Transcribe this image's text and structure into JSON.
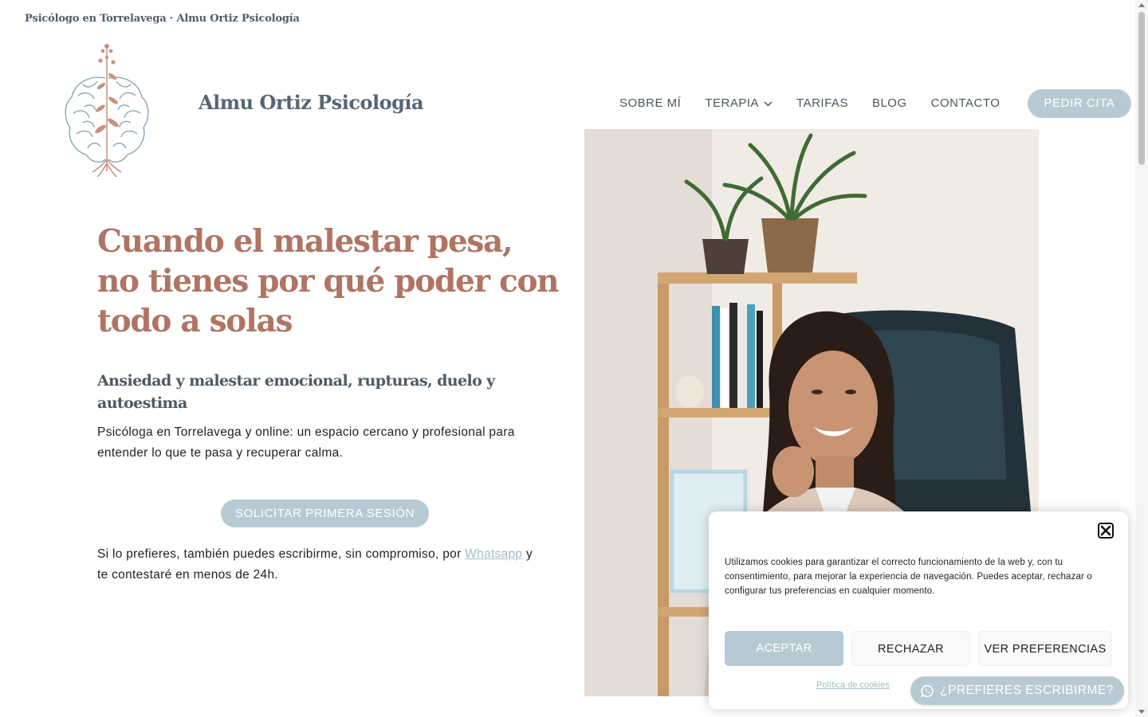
{
  "site": {
    "top_title": "Psicólogo en Torrelavega · Almu Ortiz Psicología",
    "brand_name": "Almu Ortiz Psicología",
    "logo_icon": "brain-tree-logo-icon"
  },
  "nav": {
    "items": [
      {
        "label": "SOBRE MÍ"
      },
      {
        "label": "TERAPIA",
        "has_dropdown": true
      },
      {
        "label": "TARIFAS"
      },
      {
        "label": "BLOG"
      },
      {
        "label": "CONTACTO"
      }
    ],
    "cta_label": "PEDIR CITA"
  },
  "hero": {
    "title": "Cuando el malestar pesa, no tienes por qué poder con todo a solas",
    "subtitle": "Ansiedad y malestar emocional, rupturas, duelo y autoestima",
    "text": "Psicóloga en Torrelavega y online: un espacio cercano y profesional para entender lo que te pasa y recuperar calma.",
    "button_label": "SOLICITAR PRIMERA SESIÓN",
    "note_prefix": "Si lo prefieres, también puedes escribirme, sin compromiso, por",
    "note_link": "Whatsapp",
    "note_suffix": "y te contestaré en menos de 24h."
  },
  "cookie": {
    "text": "Utilizamos cookies para garantizar el correcto funcionamiento de la web y, con tu consentimiento, para mejorar la experiencia de navegación. Puedes aceptar, rechazar o configurar tus preferencias en cualquier momento.",
    "accept_label": "ACEPTAR",
    "reject_label": "RECHAZAR",
    "preferences_label": "VER PREFERENCIAS",
    "policy_link": "Política de cookies"
  },
  "whatsapp": {
    "label": "¿PREFIERES ESCRIBIRME?"
  },
  "colors": {
    "accent": "#b7cad4",
    "title": "#b07463",
    "heading": "#4d5a65"
  }
}
